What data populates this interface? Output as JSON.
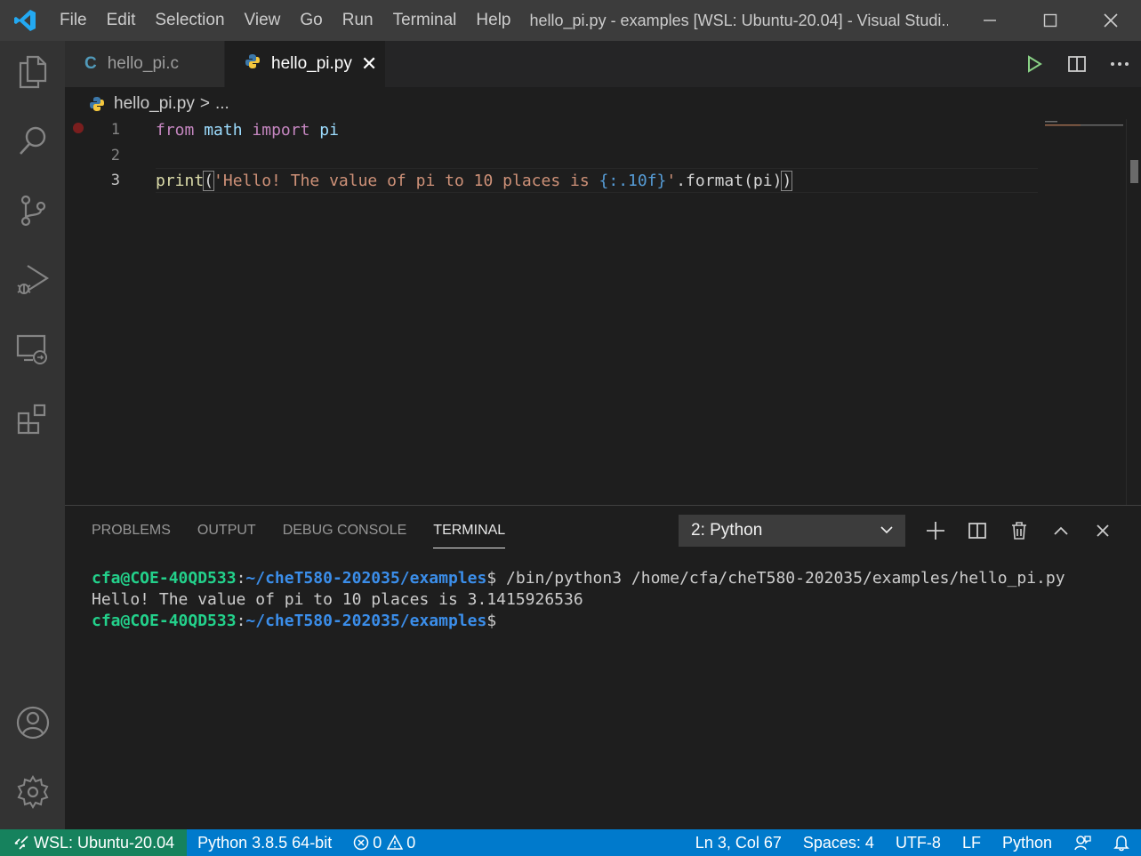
{
  "titlebar": {
    "menu": [
      "File",
      "Edit",
      "Selection",
      "View",
      "Go",
      "Run",
      "Terminal",
      "Help"
    ],
    "window_title": "hello_pi.py - examples [WSL: Ubuntu-20.04] - Visual Studi...",
    "app_logo": "vscode-logo-icon",
    "controls": [
      "minimize-icon",
      "maximize-icon",
      "close-icon"
    ]
  },
  "activitybar": {
    "items": [
      "explorer-icon",
      "search-icon",
      "source-control-icon",
      "run-debug-icon",
      "remote-explorer-icon",
      "extensions-icon"
    ],
    "bottom": [
      "accounts-icon",
      "settings-gear-icon"
    ]
  },
  "tabs": [
    {
      "label": "hello_pi.c",
      "icon_text": "C",
      "icon_color": "#519aba",
      "active": false
    },
    {
      "label": "hello_pi.py",
      "icon": "python-icon",
      "active": true,
      "close": "✕"
    }
  ],
  "tab_actions": [
    "run-python-icon",
    "split-editor-icon",
    "more-actions-icon"
  ],
  "breadcrumb": {
    "file": "hello_pi.py",
    "separator": ">",
    "rest": "..."
  },
  "editor": {
    "lines": [
      {
        "number": "1",
        "tokens": [
          "from",
          "math",
          "import",
          "pi"
        ],
        "breakpoint": true
      },
      {
        "number": "2",
        "tokens": []
      },
      {
        "number": "3",
        "tokens": [
          "print",
          "(",
          "'Hello! The value of pi to 10 places is ",
          "{:.10f}",
          "'",
          ".format(pi)",
          ")"
        ],
        "current": true
      }
    ]
  },
  "panel": {
    "tabs": [
      "PROBLEMS",
      "OUTPUT",
      "DEBUG CONSOLE",
      "TERMINAL"
    ],
    "active_tab": "TERMINAL",
    "terminal_select": "2: Python",
    "actions": [
      "new-terminal-icon",
      "split-terminal-icon",
      "kill-terminal-icon",
      "maximize-panel-icon",
      "close-panel-icon"
    ],
    "terminal": {
      "line1_user": "cfa@COE-40QD533",
      "line1_colon": ":",
      "line1_path": "~/cheT580-202035/examples",
      "line1_cmd": "$ /bin/python3 /home/cfa/cheT580-202035/examples/hello_pi.py",
      "line2": "Hello! The value of pi to 10 places is 3.1415926536",
      "line3_user": "cfa@COE-40QD533",
      "line3_colon": ":",
      "line3_path": "~/cheT580-202035/examples",
      "line3_prompt": "$"
    }
  },
  "statusbar": {
    "remote": "WSL: Ubuntu-20.04",
    "interpreter": "Python 3.8.5 64-bit",
    "errors": "0",
    "warnings": "0",
    "position": "Ln 3, Col 67",
    "spaces": "Spaces: 4",
    "encoding": "UTF-8",
    "eol": "LF",
    "language": "Python"
  },
  "colors": {
    "accent": "#007acc",
    "remote": "#16825d",
    "keyword": "#c586c0",
    "string": "#ce9178"
  }
}
